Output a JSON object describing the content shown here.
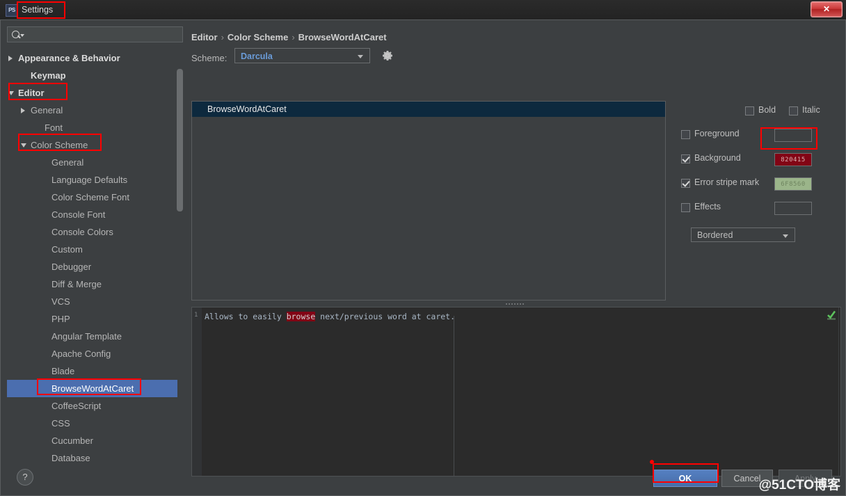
{
  "window": {
    "title": "Settings",
    "app_icon_text": "PS",
    "close_label": "✕"
  },
  "sidebar": {
    "search_placeholder": "",
    "search_value": "",
    "search_icon": "search-icon",
    "items": [
      {
        "label": "Appearance & Behavior",
        "indent": 0,
        "arrow": "right",
        "bold": true,
        "selected": false
      },
      {
        "label": "Keymap",
        "indent": 1,
        "arrow": "none",
        "bold": true,
        "selected": false
      },
      {
        "label": "Editor",
        "indent": 0,
        "arrow": "down",
        "bold": true,
        "selected": false
      },
      {
        "label": "General",
        "indent": 1,
        "arrow": "right",
        "bold": false,
        "selected": false
      },
      {
        "label": "Font",
        "indent": 2,
        "arrow": "none",
        "bold": false,
        "selected": false
      },
      {
        "label": "Color Scheme",
        "indent": 1,
        "arrow": "down",
        "bold": false,
        "selected": false
      },
      {
        "label": "General",
        "indent": 3,
        "arrow": "none",
        "bold": false,
        "selected": false
      },
      {
        "label": "Language Defaults",
        "indent": 3,
        "arrow": "none",
        "bold": false,
        "selected": false
      },
      {
        "label": "Color Scheme Font",
        "indent": 3,
        "arrow": "none",
        "bold": false,
        "selected": false
      },
      {
        "label": "Console Font",
        "indent": 3,
        "arrow": "none",
        "bold": false,
        "selected": false
      },
      {
        "label": "Console Colors",
        "indent": 3,
        "arrow": "none",
        "bold": false,
        "selected": false
      },
      {
        "label": "Custom",
        "indent": 3,
        "arrow": "none",
        "bold": false,
        "selected": false
      },
      {
        "label": "Debugger",
        "indent": 3,
        "arrow": "none",
        "bold": false,
        "selected": false
      },
      {
        "label": "Diff & Merge",
        "indent": 3,
        "arrow": "none",
        "bold": false,
        "selected": false
      },
      {
        "label": "VCS",
        "indent": 3,
        "arrow": "none",
        "bold": false,
        "selected": false
      },
      {
        "label": "PHP",
        "indent": 3,
        "arrow": "none",
        "bold": false,
        "selected": false
      },
      {
        "label": "Angular Template",
        "indent": 3,
        "arrow": "none",
        "bold": false,
        "selected": false
      },
      {
        "label": "Apache Config",
        "indent": 3,
        "arrow": "none",
        "bold": false,
        "selected": false
      },
      {
        "label": "Blade",
        "indent": 3,
        "arrow": "none",
        "bold": false,
        "selected": false
      },
      {
        "label": "BrowseWordAtCaret",
        "indent": 3,
        "arrow": "none",
        "bold": false,
        "selected": true
      },
      {
        "label": "CoffeeScript",
        "indent": 3,
        "arrow": "none",
        "bold": false,
        "selected": false
      },
      {
        "label": "CSS",
        "indent": 3,
        "arrow": "none",
        "bold": false,
        "selected": false
      },
      {
        "label": "Cucumber",
        "indent": 3,
        "arrow": "none",
        "bold": false,
        "selected": false
      },
      {
        "label": "Database",
        "indent": 3,
        "arrow": "none",
        "bold": false,
        "selected": false
      }
    ]
  },
  "content": {
    "breadcrumb": [
      "Editor",
      "Color Scheme",
      "BrowseWordAtCaret"
    ],
    "breadcrumb_separator": "›",
    "scheme": {
      "label": "Scheme:",
      "value": "Darcula",
      "gear_icon": "gear-icon"
    },
    "entries": [
      {
        "label": "BrowseWordAtCaret",
        "selected": true
      }
    ],
    "attributes": {
      "bold": {
        "label": "Bold",
        "checked": false
      },
      "italic": {
        "label": "Italic",
        "checked": false
      },
      "foreground": {
        "label": "Foreground",
        "checked": false,
        "swatch_value": "",
        "swatch_color": "#3c3f41"
      },
      "background": {
        "label": "Background",
        "checked": true,
        "swatch_value": "820415",
        "swatch_color": "#820415",
        "swatch_text_color": "#d8b0b0"
      },
      "error_stripe_mark": {
        "label": "Error stripe mark",
        "checked": true,
        "swatch_value": "6F8560",
        "swatch_color": "#9bb58a",
        "swatch_text_color": "#6f8560"
      },
      "effects": {
        "label": "Effects",
        "checked": false,
        "swatch_value": "",
        "swatch_color": "#3c3f41",
        "type_value": "Bordered"
      }
    },
    "preview": {
      "line_number": "1",
      "text_before": "Allows to easily ",
      "highlight": "browse",
      "text_after": " next/previous word at caret.",
      "check_icon": "green-check-icon"
    }
  },
  "bottombar": {
    "help_label": "?",
    "ok_label": "OK",
    "cancel_label": "Cancel",
    "apply_label": "Apply"
  },
  "watermark": "@51CTO博客",
  "colors": {
    "accent_blue": "#4b6eaf",
    "annotation_red": "#ff0000",
    "background": "#3c3f41",
    "editor_bg": "#2b2b2b"
  }
}
